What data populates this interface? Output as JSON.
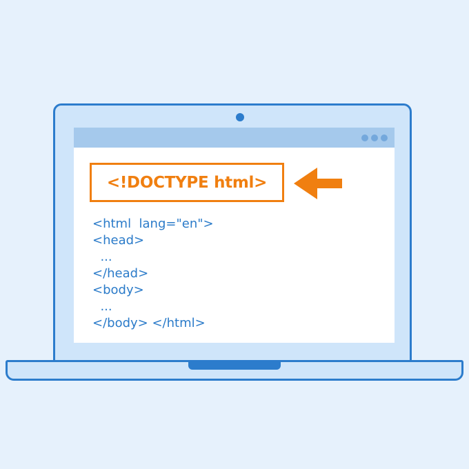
{
  "doctype": {
    "label": "<!DOCTYPE html>"
  },
  "code": {
    "lines": [
      "<html  lang=\"en\">",
      "<head>",
      "  ...",
      "</head>",
      "<body>",
      "  ...",
      "</body> </html>"
    ]
  },
  "colors": {
    "background": "#e6f1fc",
    "laptop_outline": "#2c7ccc",
    "laptop_fill": "#cfe5fa",
    "titlebar": "#a5c9ec",
    "accent_orange": "#f07f10",
    "code_blue": "#2b7bc9"
  },
  "icons": {
    "arrow": "arrow-left-icon",
    "camera": "camera-dot-icon",
    "window_controls": "window-dots-icon"
  }
}
